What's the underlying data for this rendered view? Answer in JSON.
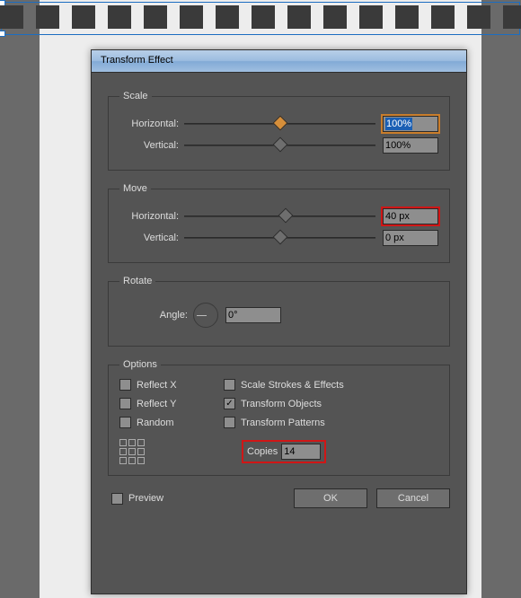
{
  "dialog": {
    "title": "Transform Effect",
    "scale": {
      "legend": "Scale",
      "h_label": "Horizontal:",
      "h_value": "100%",
      "v_label": "Vertical:",
      "v_value": "100%"
    },
    "move": {
      "legend": "Move",
      "h_label": "Horizontal:",
      "h_value": "40 px",
      "v_label": "Vertical:",
      "v_value": "0 px"
    },
    "rotate": {
      "legend": "Rotate",
      "angle_label": "Angle:",
      "angle_value": "0°"
    },
    "options": {
      "legend": "Options",
      "reflect_x": "Reflect X",
      "reflect_y": "Reflect Y",
      "random": "Random",
      "scale_strokes": "Scale Strokes & Effects",
      "transform_objects": "Transform Objects",
      "transform_patterns": "Transform Patterns",
      "copies_label": "Copies",
      "copies_value": "14",
      "transform_objects_checked": true
    },
    "footer": {
      "preview": "Preview",
      "ok": "OK",
      "cancel": "Cancel"
    }
  }
}
